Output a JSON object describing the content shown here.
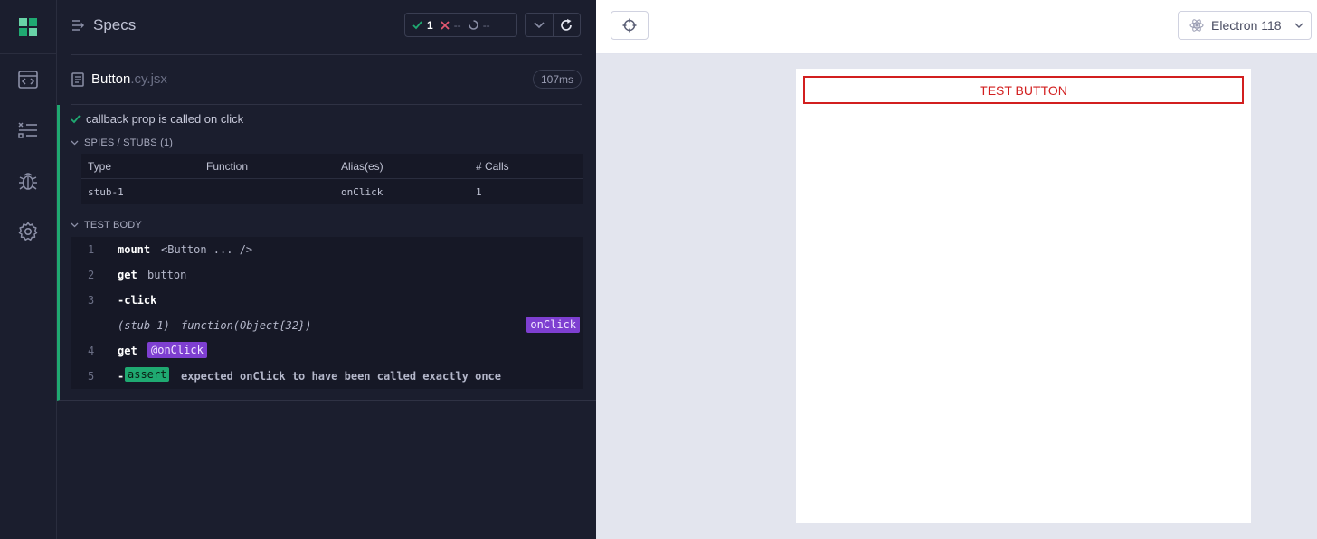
{
  "nav": {
    "items": [
      "specs-list",
      "runs",
      "debug",
      "settings"
    ]
  },
  "reporter": {
    "header": {
      "title": "Specs",
      "stats": {
        "passed": "1",
        "failed": "--",
        "pending": "--"
      }
    },
    "file": {
      "name": "Button",
      "ext": ".cy.jsx",
      "duration": "107ms"
    },
    "test": {
      "title": "callback prop is called on click",
      "spies_section": "SPIES / STUBS (1)",
      "spies_columns": [
        "Type",
        "Function",
        "Alias(es)",
        "# Calls"
      ],
      "spies_rows": [
        {
          "type": "stub-1",
          "function": "",
          "alias": "onClick",
          "calls": "1"
        }
      ],
      "body_section": "TEST BODY",
      "commands": [
        {
          "num": "1",
          "name": "mount",
          "msg": "<Button ... />"
        },
        {
          "num": "2",
          "name": "get",
          "msg": "button"
        },
        {
          "num": "3",
          "name": "-click",
          "msg": ""
        },
        {
          "num": "",
          "stub": "(stub-1)",
          "fn": "function(Object{32})",
          "alias": "onClick"
        },
        {
          "num": "4",
          "name": "get",
          "alias": "@onClick"
        },
        {
          "num": "5",
          "name": "-",
          "badge": "assert",
          "msg": "expected onClick to have been called exactly once"
        }
      ]
    }
  },
  "aut": {
    "browser": "Electron 118",
    "button_label": "TEST BUTTON"
  },
  "colors": {
    "pass": "#1fa971",
    "fail": "#e45770",
    "alias": "#7e3fd1",
    "test_button": "#d21f1f"
  }
}
